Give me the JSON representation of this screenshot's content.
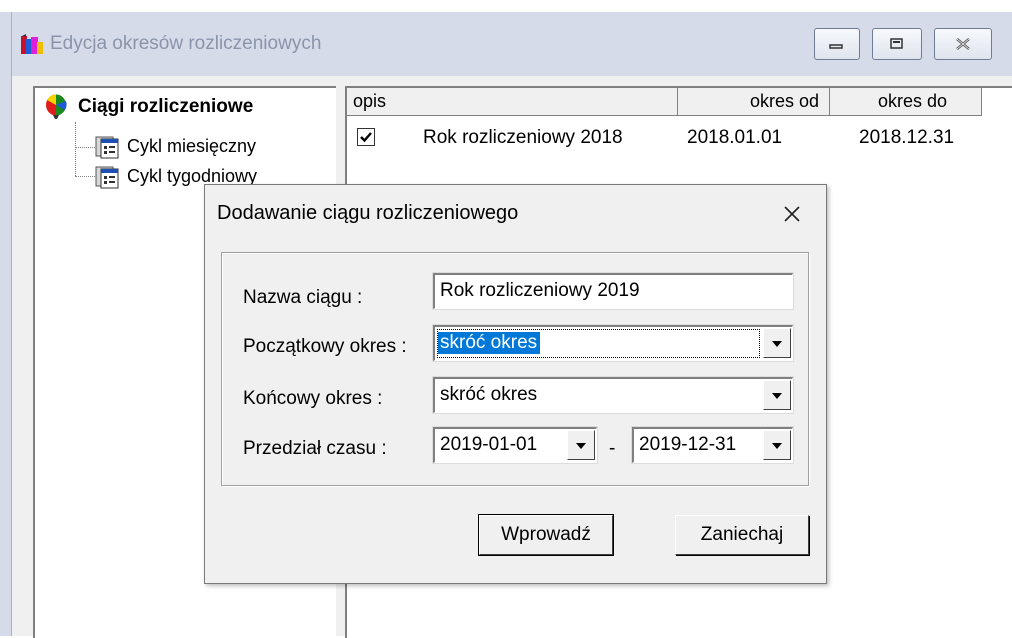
{
  "window": {
    "title": "Edycja okresów rozliczeniowych"
  },
  "tree": {
    "root": "Ciągi rozliczeniowe",
    "items": [
      {
        "label": "Cykl miesięczny"
      },
      {
        "label": "Cykl tygodniowy"
      }
    ]
  },
  "list": {
    "columns": [
      "opis",
      "okres od",
      "okres do"
    ],
    "rows": [
      {
        "checked": true,
        "opis": "Rok rozliczeniowy 2018",
        "od": "2018.01.01",
        "do": "2018.12.31"
      }
    ]
  },
  "dialog": {
    "title": "Dodawanie ciągu rozliczeniowego",
    "close_glyph": "×",
    "fields": {
      "name_label": "Nazwa ciągu :",
      "name_value": "Rok rozliczeniowy 2019",
      "start_label": "Początkowy okres :",
      "start_value": "skróć okres",
      "end_label": "Końcowy okres :",
      "end_value": "skróć okres",
      "range_label": "Przedział czasu :",
      "range_from": "2019-01-01",
      "range_separator": "-",
      "range_to": "2019-12-31"
    },
    "buttons": {
      "ok": "Wprowadź",
      "cancel": "Zaniechaj"
    }
  },
  "colors": {
    "selection": "#0078d7",
    "titlebar": "#d6dbe9"
  }
}
